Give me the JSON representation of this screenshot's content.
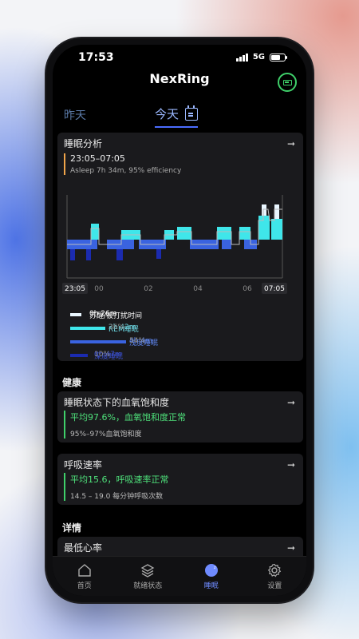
{
  "status": {
    "time": "17:53",
    "network": "5G"
  },
  "app": {
    "title": "NexRing"
  },
  "tabs": {
    "yesterday": "昨天",
    "today": "今天"
  },
  "sleep": {
    "title": "睡眠分析",
    "range": "23:05–07:05",
    "summary": "Asleep 7h 34m, 95% efficiency",
    "axis": {
      "start": "23:05",
      "t1": "00",
      "t2": "02",
      "t3": "04",
      "t4": "06",
      "end": "07:05"
    },
    "legend": [
      {
        "label": "苏醒/被打扰时间",
        "value": "0h 26m",
        "pct": "",
        "color": "#e9f6ff"
      },
      {
        "label": "REM睡眠",
        "value": "2h 42m",
        "pct": "36%",
        "color": "#3fe6ea"
      },
      {
        "label": "浅度睡眠",
        "value": "4h 4m",
        "pct": "54%",
        "color": "#3a63e0"
      },
      {
        "label": "深度睡眠",
        "value": "0h 47m",
        "pct": "10%",
        "color": "#1b2bb0"
      }
    ]
  },
  "health": {
    "heading": "健康",
    "spo2": {
      "title": "睡眠状态下的血氧饱和度",
      "main": "平均97.6%，血氧饱和度正常",
      "detail": "95%–97%血氧饱和度"
    },
    "resp": {
      "title": "呼吸速率",
      "main": "平均15.6，呼吸速率正常",
      "detail": "14.5 – 19.0 每分钟呼吸次数"
    }
  },
  "details": {
    "heading": "详情",
    "min_hr": {
      "title": "最低心率"
    }
  },
  "nav": {
    "home": "首页",
    "readiness": "就绪状态",
    "sleep": "睡眠",
    "settings": "设置"
  },
  "colors": {
    "accent": "#6f8bff",
    "ok": "#3fd06a",
    "rem": "#3fe6ea",
    "light": "#3a63e0",
    "deep": "#1b2bb0",
    "awake": "#e9f6ff"
  }
}
